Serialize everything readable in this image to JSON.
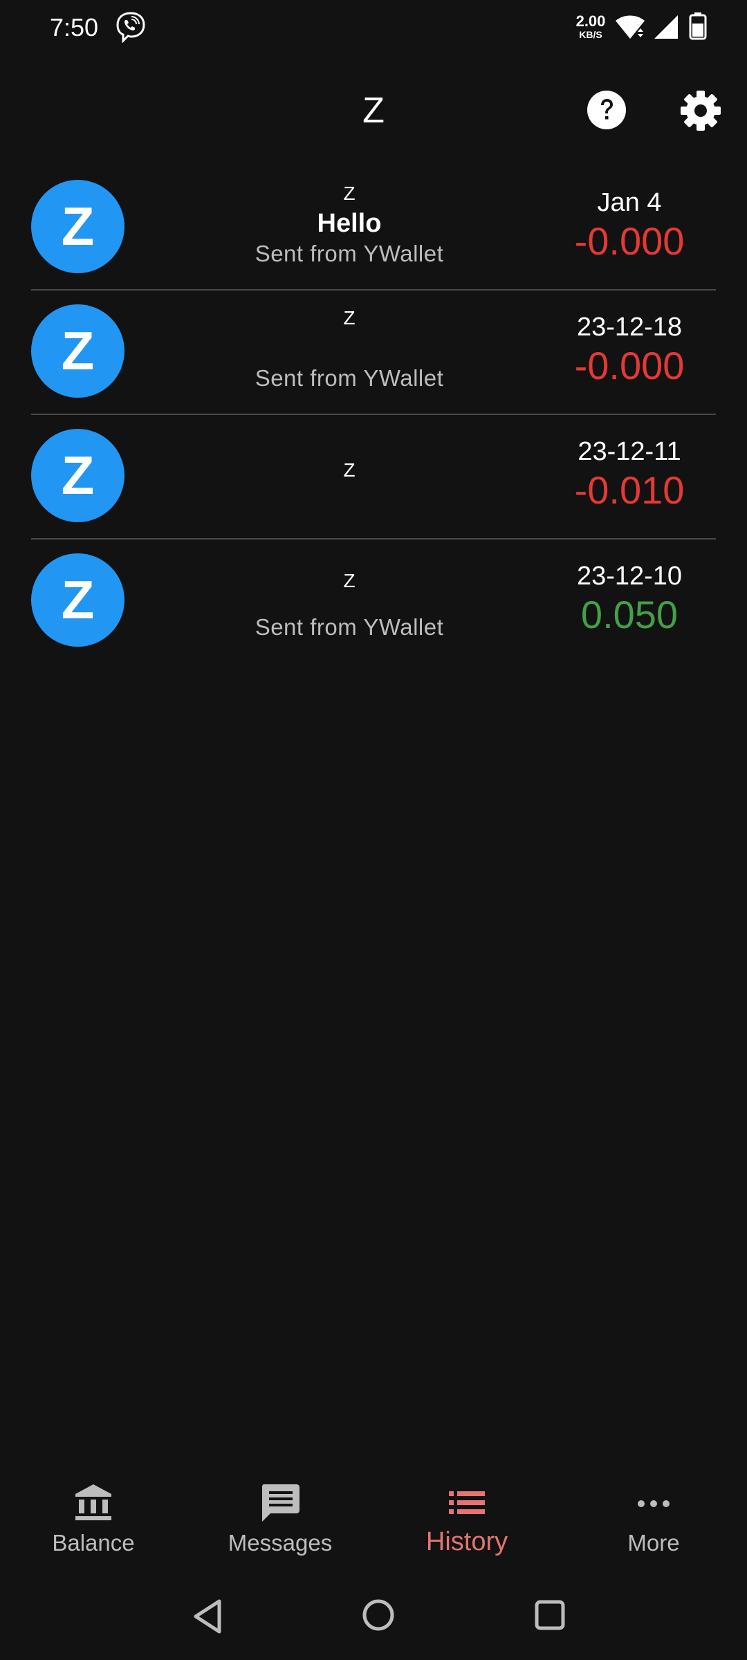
{
  "status_bar": {
    "time": "7:50",
    "net_speed_value": "2.00",
    "net_speed_unit": "KB/S",
    "icons": [
      "viber-icon",
      "wifi-icon",
      "signal-icon",
      "battery-icon"
    ]
  },
  "app_bar": {
    "title": "Z",
    "help_icon": "help-circle-icon",
    "settings_icon": "gear-icon"
  },
  "transactions": [
    {
      "avatar": "Z",
      "name": "Z",
      "memo": "Hello",
      "sub": "Sent from YWallet",
      "date": "Jan 4",
      "amount": "-0.000"
    },
    {
      "avatar": "Z",
      "name": "Z",
      "memo": "",
      "sub": "Sent from YWallet",
      "date": "23-12-18",
      "amount": "-0.000"
    },
    {
      "avatar": "Z",
      "name": "Z",
      "memo": "",
      "sub": "",
      "date": "23-12-11",
      "amount": "-0.010"
    },
    {
      "avatar": "Z",
      "name": "Z",
      "memo": "",
      "sub": "Sent from YWallet",
      "date": "23-12-10",
      "amount": "0.050"
    }
  ],
  "bottom_nav": {
    "items": [
      {
        "label": "Balance",
        "icon": "bank-icon"
      },
      {
        "label": "Messages",
        "icon": "message-icon"
      },
      {
        "label": "History",
        "icon": "list-icon",
        "active": true
      },
      {
        "label": "More",
        "icon": "more-horizontal-icon"
      }
    ]
  },
  "colors": {
    "background": "#121212",
    "avatar": "#2196f3",
    "negative_amount": "#e53935",
    "positive_amount": "#43a047",
    "active_nav": "#e57373"
  }
}
